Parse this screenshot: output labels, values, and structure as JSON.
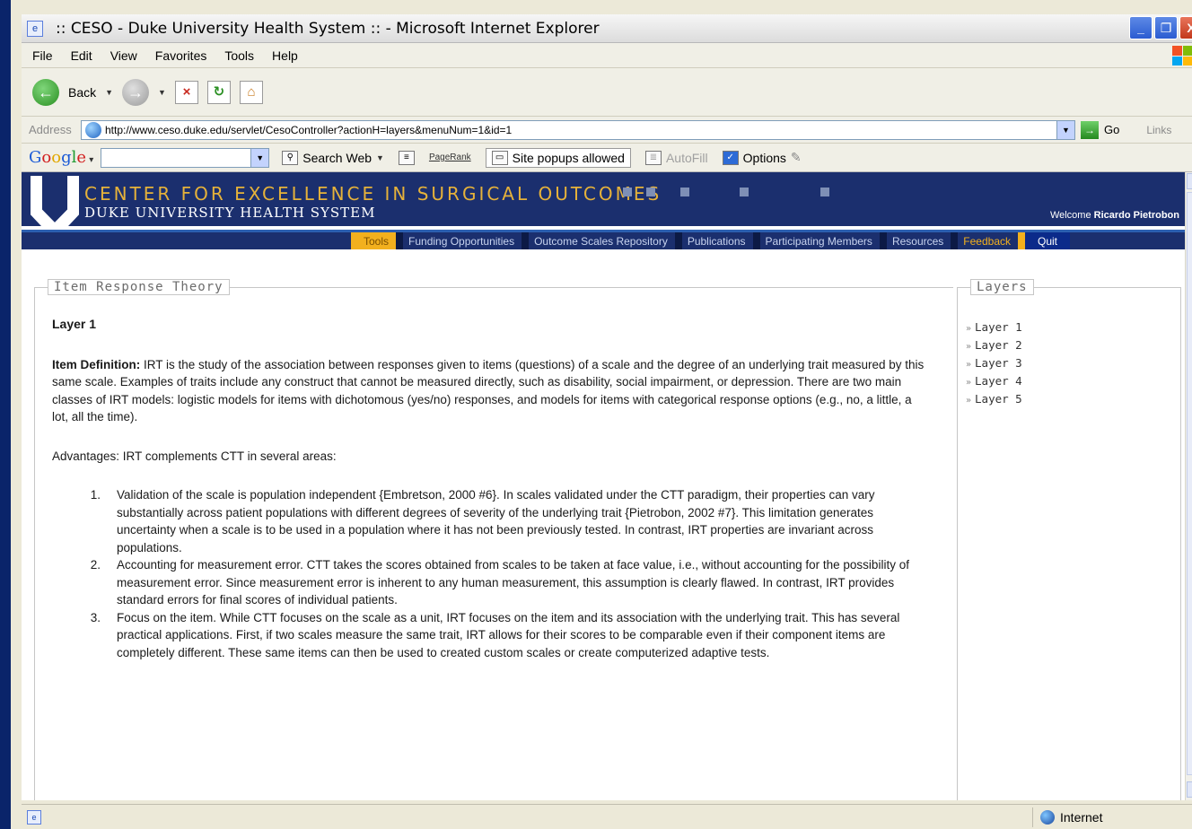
{
  "window": {
    "title": ":: CESO - Duke University Health System :: - Microsoft Internet Explorer",
    "buttons": [
      "_",
      "❐",
      "X"
    ]
  },
  "menubar": [
    "File",
    "Edit",
    "View",
    "Favorites",
    "Tools",
    "Help"
  ],
  "toolbar": {
    "back_label": "Back"
  },
  "addressbar": {
    "label": "Address",
    "url": "http://www.ceso.duke.edu/servlet/CesoController?actionH=layers&menuNum=1&id=1",
    "go_label": "Go",
    "links_label": "Links"
  },
  "googlebar": {
    "search_label": "Search Web",
    "pagerank_label": "PageRank",
    "popups_label": "Site popups allowed",
    "autofill_label": "AutoFill",
    "options_label": "Options"
  },
  "site": {
    "title": "CENTER FOR EXCELLENCE IN SURGICAL OUTCOMES",
    "subtitle": "DUKE UNIVERSITY HEALTH SYSTEM",
    "welcome_prefix": "Welcome",
    "welcome_user": "Ricardo Pietrobon",
    "nav": [
      "Tools",
      "Funding Opportunities",
      "Outcome Scales Repository",
      "Publications",
      "Participating Members",
      "Resources",
      "Feedback",
      "Quit"
    ]
  },
  "main": {
    "legend": "Item Response Theory",
    "layer_heading": "Layer 1",
    "definition_label": "Item Definition:",
    "definition_text": " IRT is the study of the association between responses given to items (questions) of a scale and the degree of an underlying trait measured by this same scale. Examples of traits include any construct that cannot be measured directly, such as disability, social impairment, or depression. There are two main classes of IRT models: logistic models for items with dichotomous (yes/no) responses, and models for items with categorical response options (e.g., no, a little, a lot, all the time).",
    "advantages_intro": "Advantages: IRT complements CTT in several areas:",
    "advantages": [
      {
        "num": "1.",
        "text": "Validation of the scale is population independent {Embretson, 2000 #6}. In scales validated under the CTT paradigm, their properties can vary substantially across patient populations with different degrees of severity of the underlying trait {Pietrobon, 2002 #7}. This limitation generates uncertainty when a scale is to be used in a population where it has not been previously tested. In contrast, IRT properties are invariant across populations."
      },
      {
        "num": "2.",
        "text": "Accounting for measurement error. CTT takes the scores obtained from scales to be taken at face value, i.e., without accounting for the possibility of measurement error. Since measurement error is inherent to any human measurement, this assumption is clearly flawed. In contrast, IRT provides standard errors for final scores of individual patients."
      },
      {
        "num": "3.",
        "text": "Focus on the item. While CTT focuses on the scale as a unit, IRT focuses on the item and its association with the underlying trait. This has several practical applications. First, if two scales measure the same trait, IRT allows for their scores to be comparable even if their component items are completely different. These same items can then be used to created custom scales or create computerized adaptive tests."
      }
    ]
  },
  "sidebar": {
    "legend": "Layers",
    "layers": [
      "Layer 1",
      "Layer 2",
      "Layer 3",
      "Layer 4",
      "Layer 5"
    ]
  },
  "statusbar": {
    "zone": "Internet"
  },
  "colors": {
    "banner": "#1b2f6e",
    "accent": "#f2b01e",
    "title_gold": "#e6b23a"
  }
}
